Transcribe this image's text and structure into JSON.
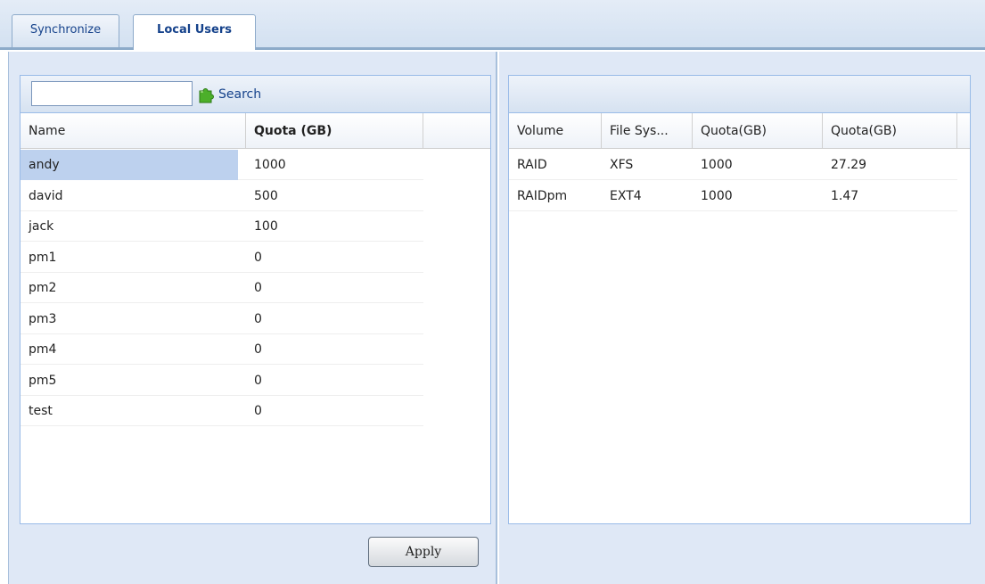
{
  "tabs": [
    {
      "label": "Synchronize"
    },
    {
      "label": "Local Users"
    }
  ],
  "users_grid": {
    "search": {
      "value": "",
      "button_label": "Search"
    },
    "columns": [
      "Name",
      "Quota (GB)"
    ],
    "rows": [
      {
        "name": "andy",
        "quota": "1000",
        "selected": true
      },
      {
        "name": "david",
        "quota": "500"
      },
      {
        "name": "jack",
        "quota": "100"
      },
      {
        "name": "pm1",
        "quota": "0"
      },
      {
        "name": "pm2",
        "quota": "0"
      },
      {
        "name": "pm3",
        "quota": "0"
      },
      {
        "name": "pm4",
        "quota": "0"
      },
      {
        "name": "pm5",
        "quota": "0"
      },
      {
        "name": "test",
        "quota": "0"
      }
    ]
  },
  "volumes_grid": {
    "columns": [
      "Volume",
      "File Sys...",
      "Quota(GB)",
      "Quota(GB)"
    ],
    "rows": [
      [
        "RAID",
        "XFS",
        "1000",
        "27.29"
      ],
      [
        "RAIDpm",
        "EXT4",
        "1000",
        "1.47"
      ]
    ]
  },
  "apply_label": "Apply",
  "colors": {
    "selection": "#bdd1ee",
    "panel_bg": "#dfe8f6",
    "border": "#99bbe8",
    "header_text": "#15428b"
  }
}
